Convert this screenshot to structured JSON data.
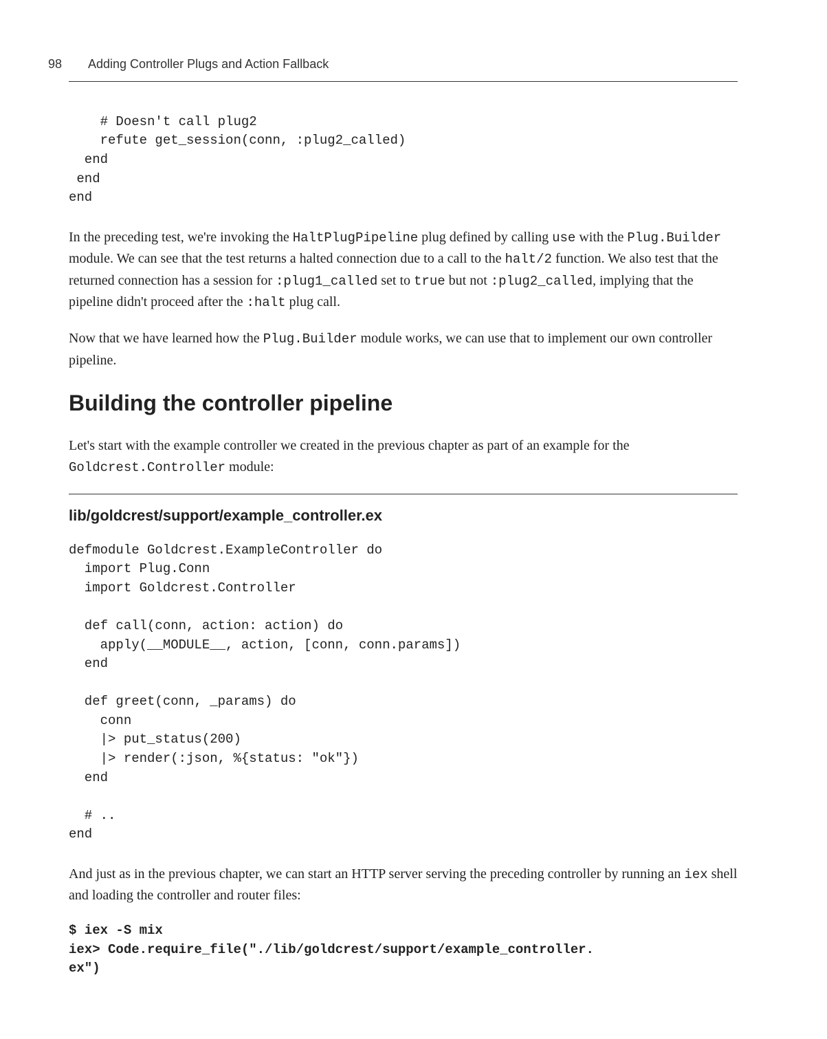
{
  "header": {
    "page_number": "98",
    "chapter_title": "Adding Controller Plugs and Action Fallback"
  },
  "content": {
    "code1": "    # Doesn't call plug2\n    refute get_session(conn, :plug2_called)\n  end\n end\nend",
    "para1_pre": "In the preceding test, we're invoking the ",
    "para1_c1": "HaltPlugPipeline",
    "para1_mid1": " plug defined by calling ",
    "para1_c2": "use",
    "para1_mid2": " with the ",
    "para1_c3": "Plug.Builder",
    "para1_mid3": " module. We can see that the test returns a halted connection due to a call to the ",
    "para1_c4": "halt/2",
    "para1_mid4": " function. We also test that the returned connection has a session for ",
    "para1_c5": ":plug1_called",
    "para1_mid5": " set to ",
    "para1_c6": "true",
    "para1_mid6": " but not ",
    "para1_c7": ":plug2_called",
    "para1_mid7": ", implying that the pipeline didn't proceed after the ",
    "para1_c8": ":halt",
    "para1_post": " plug call.",
    "para2_pre": "Now that we have learned how the ",
    "para2_c1": "Plug.Builder",
    "para2_post": " module works, we can use that to implement our own controller pipeline.",
    "heading": "Building the controller pipeline",
    "para3_pre": "Let's start with the example controller we created in the previous chapter as part of an example for the ",
    "para3_c1": "Goldcrest.Controller",
    "para3_post": " module:",
    "file_heading": "lib/goldcrest/support/example_controller.ex",
    "code2": "defmodule Goldcrest.ExampleController do\n  import Plug.Conn\n  import Goldcrest.Controller\n\n  def call(conn, action: action) do\n    apply(__MODULE__, action, [conn, conn.params])\n  end\n\n  def greet(conn, _params) do\n    conn\n    |> put_status(200)\n    |> render(:json, %{status: \"ok\"})\n  end\n\n  # ..\nend",
    "para4_pre": "And just as in the previous chapter, we can start an HTTP server serving the preceding controller by running an ",
    "para4_c1": "iex",
    "para4_post": " shell and loading the controller and router files:",
    "code3": "$ iex -S mix\niex> Code.require_file(\"./lib/goldcrest/support/example_controller.\nex\")"
  }
}
